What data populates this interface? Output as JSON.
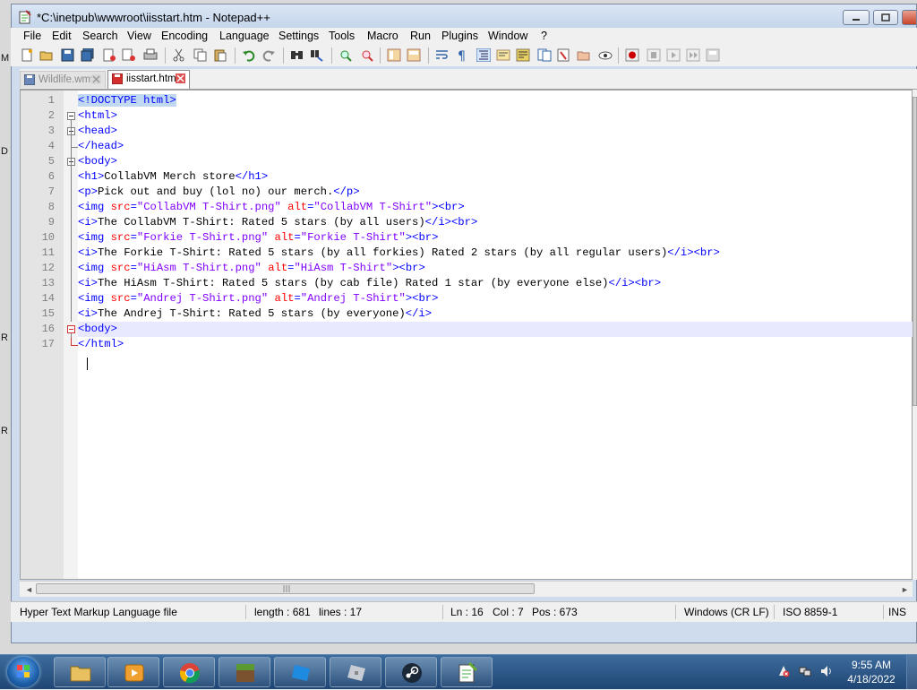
{
  "window": {
    "title": "*C:\\inetpub\\wwwroot\\iisstart.htm - Notepad++"
  },
  "menu": [
    "File",
    "Edit",
    "Search",
    "View",
    "Encoding",
    "Language",
    "Settings",
    "Tools",
    "Macro",
    "Run",
    "Plugins",
    "Window",
    "?"
  ],
  "tabs": [
    {
      "label": "Wildlife.wmv",
      "active": false
    },
    {
      "label": "iisstart.htm",
      "active": true
    }
  ],
  "editor": {
    "lines": [
      "<!DOCTYPE html>",
      "<html>",
      "<head>",
      "</head>",
      "<body>",
      "<h1>CollabVM Merch store</h1>",
      "<p>Pick out and buy (lol no) our merch.</p>",
      "<img src=\"CollabVM T-Shirt.png\" alt=\"CollabVM T-Shirt\"><br>",
      "<i>The CollabVM T-Shirt: Rated 5 stars (by all users)</i><br>",
      "<img src=\"Forkie T-Shirt.png\" alt=\"Forkie T-Shirt\"><br>",
      "<i>The Forkie T-Shirt: Rated 5 stars (by all forkies) Rated 2 stars (by all regular users)</i><br>",
      "<img src=\"HiAsm T-Shirt.png\" alt=\"HiAsm T-Shirt\"><br>",
      "<i>The HiAsm T-Shirt: Rated 5 stars (by cab file) Rated 1 star (by everyone else)</i><br>",
      "<img src=\"Andrej T-Shirt.png\" alt=\"Andrej T-Shirt\"><br>",
      "<i>The Andrej T-Shirt: Rated 5 stars (by everyone)</i>",
      "<body>",
      "</html>"
    ],
    "current_line": 16
  },
  "status": {
    "file_type": "Hyper Text Markup Language file",
    "length": "length : 681",
    "lines": "lines : 17",
    "ln": "Ln : 16",
    "col": "Col : 7",
    "pos": "Pos : 673",
    "eol": "Windows (CR LF)",
    "encoding": "ISO 8859-1",
    "mode": "INS"
  },
  "desktop_letters": [
    "M",
    "D",
    "R",
    "R"
  ],
  "taskbar": {
    "apps": [
      "folder-icon",
      "media-player-icon",
      "chrome-icon",
      "minecraft-icon",
      "roblox-icon",
      "roblox-alt-icon",
      "steam-icon",
      "notepadpp-icon"
    ],
    "time": "9:55 AM",
    "date": "4/18/2022"
  },
  "colors": {
    "tag": "#0000ff",
    "attr": "#ff0000",
    "string": "#8000ff",
    "current_line": "#e8e8ff",
    "taskbar": "#1f4673"
  }
}
